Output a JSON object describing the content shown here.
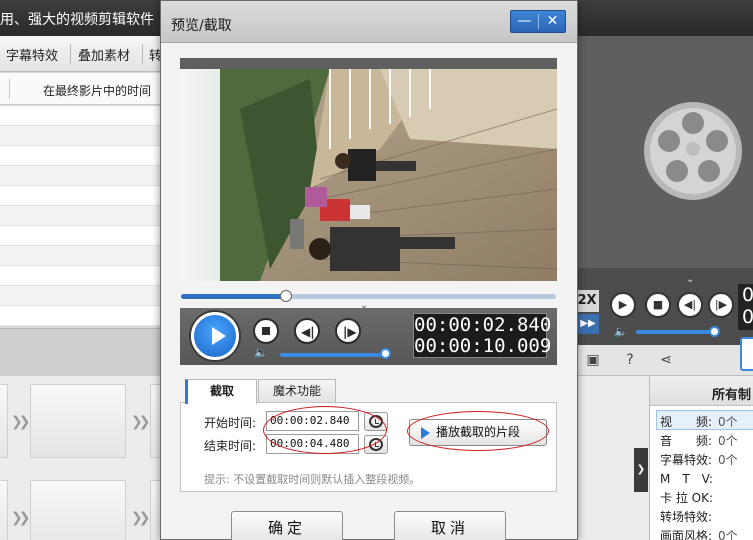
{
  "app": {
    "title": "用、强大的视频剪辑软件",
    "tabs": [
      "字幕特效",
      "叠加素材",
      "转"
    ],
    "column_header": "在最终影片中的时间"
  },
  "right_panel": {
    "speed_label": "2X",
    "time_partial": [
      "0",
      "0"
    ],
    "header": "所有制",
    "rows": [
      {
        "key": "视　　频:",
        "value": "0个"
      },
      {
        "key": "音　　频:",
        "value": "0个"
      },
      {
        "key": "字幕特效:",
        "value": "0个"
      },
      {
        "key": "M　T　V:",
        "value": ""
      },
      {
        "key": "卡 拉 OK:",
        "value": ""
      },
      {
        "key": "转场特效:",
        "value": ""
      },
      {
        "key": "画面风格:",
        "value": "0个"
      }
    ]
  },
  "dialog": {
    "title": "预览/截取",
    "minimize_symbol": "—",
    "close_symbol": "✕",
    "player": {
      "current_time": "00:00:02.840",
      "total_time": "00:00:10.009",
      "seek_progress": 0.28,
      "volume": 1.0
    },
    "tabs": {
      "clip": "截取",
      "magic": "魔术功能"
    },
    "start_label": "开始时间:",
    "start_value": "00:00:02.840",
    "end_label": "结束时间:",
    "end_value": "00:00:04.480",
    "play_clip_label": "播放截取的片段",
    "hint": "提示: 不设置截取时间则默认插入整段视频。",
    "ok_label": "确定",
    "cancel_label": "取消"
  },
  "colors": {
    "accent_blue": "#2d7bd5",
    "annotation_red": "#d21c1c",
    "dark_panel": "#565656"
  }
}
